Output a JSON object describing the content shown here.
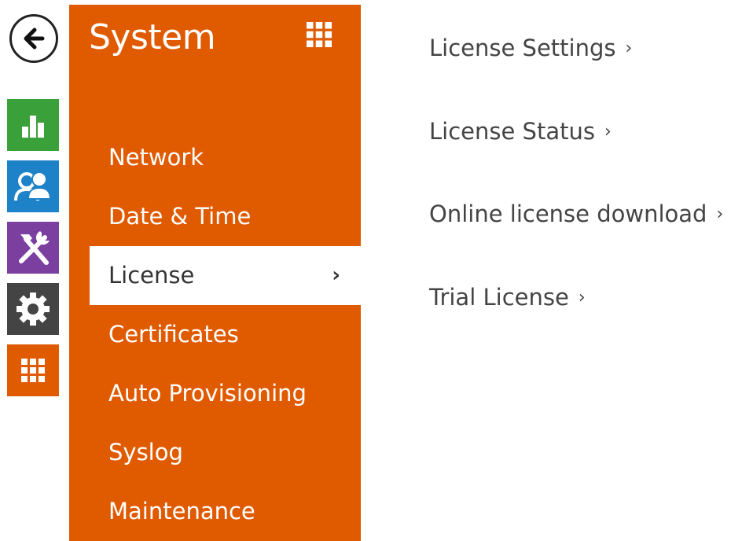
{
  "rail": {
    "back_icon": "arrow-left-icon",
    "items": [
      {
        "icon": "bar-chart-icon",
        "color": "#3aa13a"
      },
      {
        "icon": "users-icon",
        "color": "#1e82c8"
      },
      {
        "icon": "tools-icon",
        "color": "#7b3fa0"
      },
      {
        "icon": "gear-icon",
        "color": "#444444"
      },
      {
        "icon": "grid-icon",
        "color": "#e05a00"
      }
    ]
  },
  "menu": {
    "title": "System",
    "accent_color": "#e05a00",
    "grid_icon": "grid-icon",
    "items": [
      {
        "label": "Network"
      },
      {
        "label": "Date & Time"
      },
      {
        "label": "License",
        "active": true,
        "chevron": "›"
      },
      {
        "label": "Certificates"
      },
      {
        "label": "Auto Provisioning"
      },
      {
        "label": "Syslog"
      },
      {
        "label": "Maintenance"
      }
    ]
  },
  "content": {
    "links": [
      {
        "label": "License Settings",
        "arrow": "›"
      },
      {
        "label": "License Status",
        "arrow": "›"
      },
      {
        "label": "Online license download",
        "arrow": "›"
      },
      {
        "label": "Trial License",
        "arrow": "›"
      }
    ]
  }
}
